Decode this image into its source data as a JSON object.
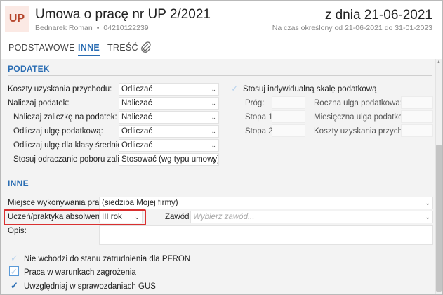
{
  "header": {
    "badge": "UP",
    "title": "Umowa o pracę nr UP 2/2021",
    "employee": "Bednarek Roman",
    "employee_id": "04210122239",
    "date_title": "z dnia 21-06-2021",
    "period": "Na czas określony od 21-06-2021 do 31-01-2023"
  },
  "tabs": [
    {
      "label": "PODSTAWOWE"
    },
    {
      "label": "INNE"
    },
    {
      "label": "TREŚĆ"
    }
  ],
  "podatek": {
    "title": "PODATEK",
    "rows": [
      {
        "label": "Koszty uzyskania przychodu:",
        "value": "Odliczać"
      },
      {
        "label": "Naliczaj podatek:",
        "value": "Naliczać"
      },
      {
        "label": "Naliczaj zaliczkę na podatek:",
        "value": "Naliczać"
      },
      {
        "label": "Odliczaj ulgę podatkową:",
        "value": "Odliczać"
      },
      {
        "label": "Odliczaj ulgę dla klasy średniej:",
        "value": "Odliczać"
      },
      {
        "label": "Stosuj odraczanie poboru zaliczek:",
        "value": "Stosować (wg typu umowy)"
      }
    ],
    "individual_scale_label": "Stosuj indywidualną skalę podatkową",
    "prog_label": "Próg:",
    "stopa1_label": "Stopa 1:",
    "stopa2_label": "Stopa 2:",
    "roczna_ulga_label": "Roczna ulga podatkowa:",
    "miesieczna_ulga_label": "Miesięczna ulga podatkowa:",
    "koszty_label": "Koszty uzyskania przychodu:"
  },
  "inne": {
    "title": "INNE",
    "miejsce_label": "Miejsce wykonywania pracy:",
    "miejsce_value": "(siedziba Mojej firmy)",
    "uczen_label": "Uczeń/praktyka absolwencka:",
    "uczen_value": "III rok",
    "zawod_label": "Zawód:",
    "zawod_placeholder": "Wybierz zawód...",
    "opis_label": "Opis:",
    "checkboxes": [
      {
        "label": "Nie wchodzi do stanu zatrudnienia dla PFRON",
        "checked": false
      },
      {
        "label": "Praca w warunkach zagrożenia",
        "checked": false
      },
      {
        "label": "Uwzględniaj w sprawozdaniach GUS",
        "checked": true
      }
    ]
  },
  "colors": {
    "accent": "#2a6db3",
    "badge_bg": "#fbe9e4",
    "badge_fg": "#b5452b",
    "highlight": "#d93030"
  },
  "icons": {
    "attachment": "paperclip-icon",
    "dropdown": "chevron-down-icon",
    "check": "checkmark-icon"
  }
}
